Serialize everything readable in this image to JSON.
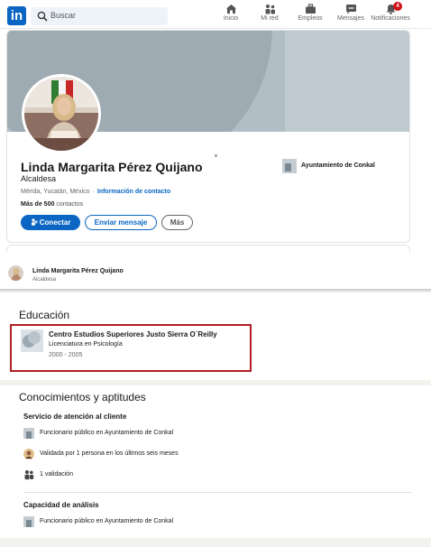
{
  "nav": {
    "logo": "in",
    "search_placeholder": "Buscar",
    "items": [
      {
        "label": "Inicio"
      },
      {
        "label": "Mi red"
      },
      {
        "label": "Empleos"
      },
      {
        "label": "Mensajes"
      },
      {
        "label": "Notificaciones",
        "badge": "4"
      }
    ]
  },
  "profile": {
    "name": "Linda Margarita Pérez Quijano",
    "headline": "Alcaldesa",
    "location": "Mérida, Yucatán, México",
    "contact_link": "Información de contacto",
    "contacts_count": "Más de 500",
    "contacts_label": "contactos",
    "buttons": {
      "connect": "Conectar",
      "message": "Enviar mensaje",
      "more": "Más"
    },
    "current_company": "Ayuntamiento de Conkal"
  },
  "sticky": {
    "name": "Linda Margarita Pérez Quijano",
    "headline": "Alcaldesa"
  },
  "education": {
    "title": "Educación",
    "items": [
      {
        "school": "Centro Estudios Superiores Justo Sierra O´Reilly",
        "degree": "Licenciatura en Psicología",
        "dates": "2000 - 2005"
      }
    ]
  },
  "skills": {
    "title": "Conocimientos y aptitudes",
    "items": [
      {
        "name": "Servicio de atención al cliente",
        "lines": [
          "Funcionario público en Ayuntamiento de Conkal",
          "Validada por 1 persona en los últimos seis meses",
          "1 validación"
        ]
      },
      {
        "name": "Capacidad de análisis",
        "lines": [
          "Funcionario público en Ayuntamiento de Conkal"
        ]
      }
    ]
  },
  "colors": {
    "brand": "#0a66c2",
    "highlight_box": "#b01e23",
    "badge": "#cc1016"
  }
}
